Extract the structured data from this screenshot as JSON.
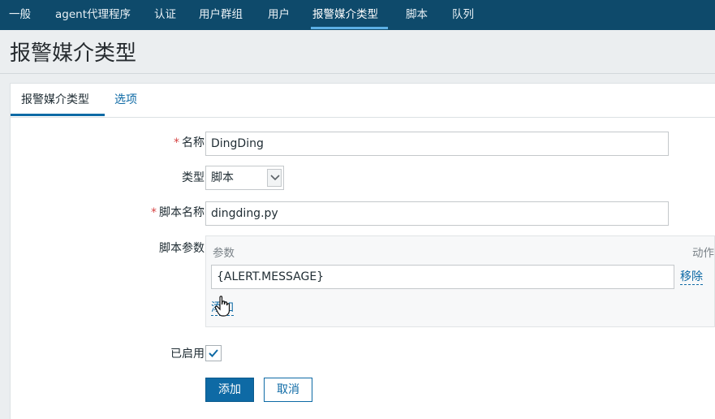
{
  "topnav": {
    "items": [
      "一般",
      "agent代理程序",
      "认证",
      "用户群组",
      "用户",
      "报警媒介类型",
      "脚本",
      "队列"
    ],
    "active_index": 5
  },
  "page": {
    "title": "报警媒介类型"
  },
  "tabs": [
    {
      "label": "报警媒介类型",
      "active": true
    },
    {
      "label": "选项",
      "active": false
    }
  ],
  "form": {
    "name": {
      "label": "名称",
      "required": "*",
      "value": "DingDing"
    },
    "type": {
      "label": "类型",
      "selected": "脚本"
    },
    "script_name": {
      "label": "脚本名称",
      "required": "*",
      "value": "dingding.py"
    },
    "script_params": {
      "label": "脚本参数",
      "header_param": "参数",
      "header_action": "动作",
      "rows": [
        {
          "value": "{ALERT.MESSAGE}",
          "remove_label": "移除"
        }
      ],
      "add_label": "添加"
    },
    "enabled": {
      "label": "已启用",
      "checked": true
    }
  },
  "buttons": {
    "add": "添加",
    "cancel": "取消"
  },
  "colors": {
    "nav_bg": "#0e4a6b",
    "accent": "#0e6aa5",
    "required": "#d64444"
  }
}
